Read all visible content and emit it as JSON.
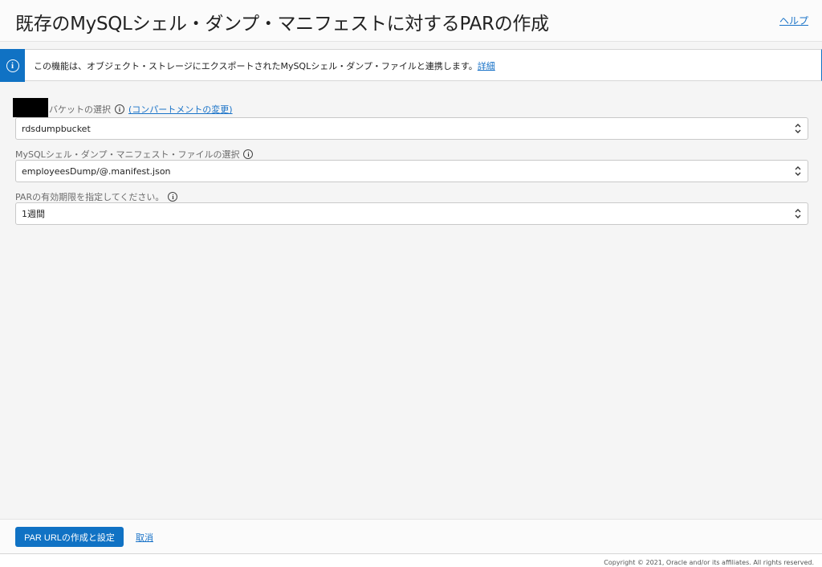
{
  "header": {
    "title": "既存のMySQLシェル・ダンプ・マニフェストに対するPARの作成",
    "help_link": "ヘルプ"
  },
  "info_banner": {
    "text": "この機能は、オブジェクト・ストレージにエクスポートされたMySQLシェル・ダンプ・ファイルと連携します。",
    "link": "詳細"
  },
  "form": {
    "bucket": {
      "label": "バケットの選択",
      "change_compartment": "(コンパートメントの変更)",
      "value": "rdsdumpbucket"
    },
    "manifest": {
      "label": "MySQLシェル・ダンプ・マニフェスト・ファイルの選択",
      "value": "employeesDump/@.manifest.json"
    },
    "expiry": {
      "label": "PARの有効期限を指定してください。",
      "value": "1週間"
    }
  },
  "footer": {
    "create_button": "PAR URLの作成と設定",
    "cancel": "取消"
  },
  "copyright": "Copyright © 2021, Oracle and/or its affiliates. All rights reserved.",
  "colors": {
    "accent": "#1072c4",
    "link": "#1a73c8",
    "background": "#f5f5f5"
  },
  "icons": {
    "info": "info-circle-icon",
    "help": "help-info-icon",
    "select": "up-down-chevron-icon"
  }
}
